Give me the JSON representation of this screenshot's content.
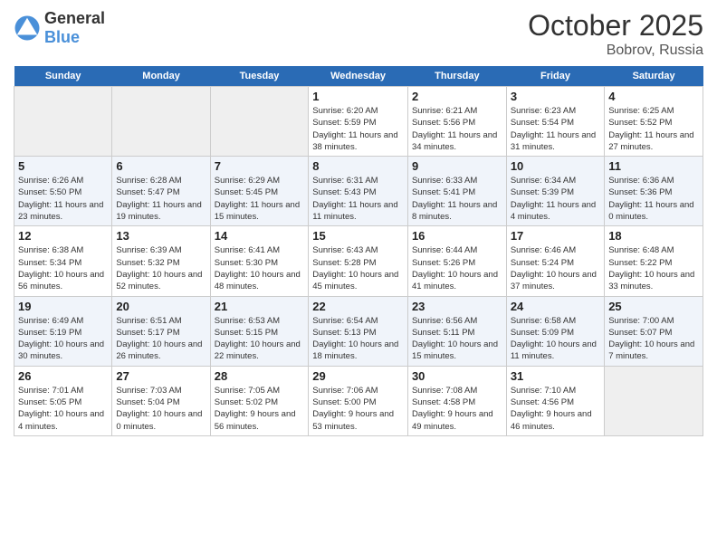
{
  "header": {
    "logo_general": "General",
    "logo_blue": "Blue",
    "month_title": "October 2025",
    "location": "Bobrov, Russia"
  },
  "days_of_week": [
    "Sunday",
    "Monday",
    "Tuesday",
    "Wednesday",
    "Thursday",
    "Friday",
    "Saturday"
  ],
  "weeks": [
    [
      {
        "day": "",
        "empty": true
      },
      {
        "day": "",
        "empty": true
      },
      {
        "day": "",
        "empty": true
      },
      {
        "day": "1",
        "sunrise": "6:20 AM",
        "sunset": "5:59 PM",
        "daylight": "11 hours and 38 minutes."
      },
      {
        "day": "2",
        "sunrise": "6:21 AM",
        "sunset": "5:56 PM",
        "daylight": "11 hours and 34 minutes."
      },
      {
        "day": "3",
        "sunrise": "6:23 AM",
        "sunset": "5:54 PM",
        "daylight": "11 hours and 31 minutes."
      },
      {
        "day": "4",
        "sunrise": "6:25 AM",
        "sunset": "5:52 PM",
        "daylight": "11 hours and 27 minutes."
      }
    ],
    [
      {
        "day": "5",
        "sunrise": "6:26 AM",
        "sunset": "5:50 PM",
        "daylight": "11 hours and 23 minutes."
      },
      {
        "day": "6",
        "sunrise": "6:28 AM",
        "sunset": "5:47 PM",
        "daylight": "11 hours and 19 minutes."
      },
      {
        "day": "7",
        "sunrise": "6:29 AM",
        "sunset": "5:45 PM",
        "daylight": "11 hours and 15 minutes."
      },
      {
        "day": "8",
        "sunrise": "6:31 AM",
        "sunset": "5:43 PM",
        "daylight": "11 hours and 11 minutes."
      },
      {
        "day": "9",
        "sunrise": "6:33 AM",
        "sunset": "5:41 PM",
        "daylight": "11 hours and 8 minutes."
      },
      {
        "day": "10",
        "sunrise": "6:34 AM",
        "sunset": "5:39 PM",
        "daylight": "11 hours and 4 minutes."
      },
      {
        "day": "11",
        "sunrise": "6:36 AM",
        "sunset": "5:36 PM",
        "daylight": "11 hours and 0 minutes."
      }
    ],
    [
      {
        "day": "12",
        "sunrise": "6:38 AM",
        "sunset": "5:34 PM",
        "daylight": "10 hours and 56 minutes."
      },
      {
        "day": "13",
        "sunrise": "6:39 AM",
        "sunset": "5:32 PM",
        "daylight": "10 hours and 52 minutes."
      },
      {
        "day": "14",
        "sunrise": "6:41 AM",
        "sunset": "5:30 PM",
        "daylight": "10 hours and 48 minutes."
      },
      {
        "day": "15",
        "sunrise": "6:43 AM",
        "sunset": "5:28 PM",
        "daylight": "10 hours and 45 minutes."
      },
      {
        "day": "16",
        "sunrise": "6:44 AM",
        "sunset": "5:26 PM",
        "daylight": "10 hours and 41 minutes."
      },
      {
        "day": "17",
        "sunrise": "6:46 AM",
        "sunset": "5:24 PM",
        "daylight": "10 hours and 37 minutes."
      },
      {
        "day": "18",
        "sunrise": "6:48 AM",
        "sunset": "5:22 PM",
        "daylight": "10 hours and 33 minutes."
      }
    ],
    [
      {
        "day": "19",
        "sunrise": "6:49 AM",
        "sunset": "5:19 PM",
        "daylight": "10 hours and 30 minutes."
      },
      {
        "day": "20",
        "sunrise": "6:51 AM",
        "sunset": "5:17 PM",
        "daylight": "10 hours and 26 minutes."
      },
      {
        "day": "21",
        "sunrise": "6:53 AM",
        "sunset": "5:15 PM",
        "daylight": "10 hours and 22 minutes."
      },
      {
        "day": "22",
        "sunrise": "6:54 AM",
        "sunset": "5:13 PM",
        "daylight": "10 hours and 18 minutes."
      },
      {
        "day": "23",
        "sunrise": "6:56 AM",
        "sunset": "5:11 PM",
        "daylight": "10 hours and 15 minutes."
      },
      {
        "day": "24",
        "sunrise": "6:58 AM",
        "sunset": "5:09 PM",
        "daylight": "10 hours and 11 minutes."
      },
      {
        "day": "25",
        "sunrise": "7:00 AM",
        "sunset": "5:07 PM",
        "daylight": "10 hours and 7 minutes."
      }
    ],
    [
      {
        "day": "26",
        "sunrise": "7:01 AM",
        "sunset": "5:05 PM",
        "daylight": "10 hours and 4 minutes."
      },
      {
        "day": "27",
        "sunrise": "7:03 AM",
        "sunset": "5:04 PM",
        "daylight": "10 hours and 0 minutes."
      },
      {
        "day": "28",
        "sunrise": "7:05 AM",
        "sunset": "5:02 PM",
        "daylight": "9 hours and 56 minutes."
      },
      {
        "day": "29",
        "sunrise": "7:06 AM",
        "sunset": "5:00 PM",
        "daylight": "9 hours and 53 minutes."
      },
      {
        "day": "30",
        "sunrise": "7:08 AM",
        "sunset": "4:58 PM",
        "daylight": "9 hours and 49 minutes."
      },
      {
        "day": "31",
        "sunrise": "7:10 AM",
        "sunset": "4:56 PM",
        "daylight": "9 hours and 46 minutes."
      },
      {
        "day": "",
        "empty": true
      }
    ]
  ]
}
